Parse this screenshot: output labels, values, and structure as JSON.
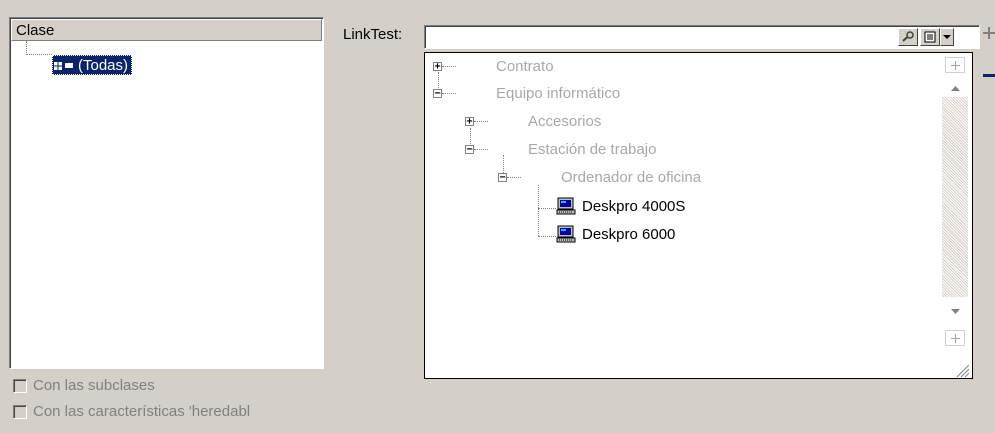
{
  "left": {
    "header": "Clase",
    "root_item": "(Todas)"
  },
  "checkboxes": {
    "subclases": "Con las subclases",
    "heredables": "Con las características 'heredabl"
  },
  "linktest": {
    "label": "LinkTest:",
    "value": ""
  },
  "tree": {
    "nodes": [
      {
        "label": "Contrato",
        "state": "collapsed",
        "style": "gray"
      },
      {
        "label": "Equipo informático",
        "state": "expanded",
        "style": "gray"
      },
      {
        "label": "Accesorios",
        "state": "collapsed",
        "style": "gray"
      },
      {
        "label": "Estación de trabajo",
        "state": "expanded",
        "style": "gray"
      },
      {
        "label": "Ordenador de oficina",
        "state": "expanded",
        "style": "gray"
      },
      {
        "label": "Deskpro 4000S",
        "state": "leaf",
        "style": "normal"
      },
      {
        "label": "Deskpro 6000",
        "state": "leaf",
        "style": "normal"
      }
    ]
  },
  "icons": {
    "search": "search-icon",
    "list": "list-icon",
    "dropdown": "chevron-down-icon",
    "add": "plus-icon",
    "remove": "minus-icon",
    "computer": "computer-icon"
  },
  "colors": {
    "selection": "#0a246a",
    "background": "#d4d0c8",
    "disabled_text": "#a8a8a8"
  }
}
